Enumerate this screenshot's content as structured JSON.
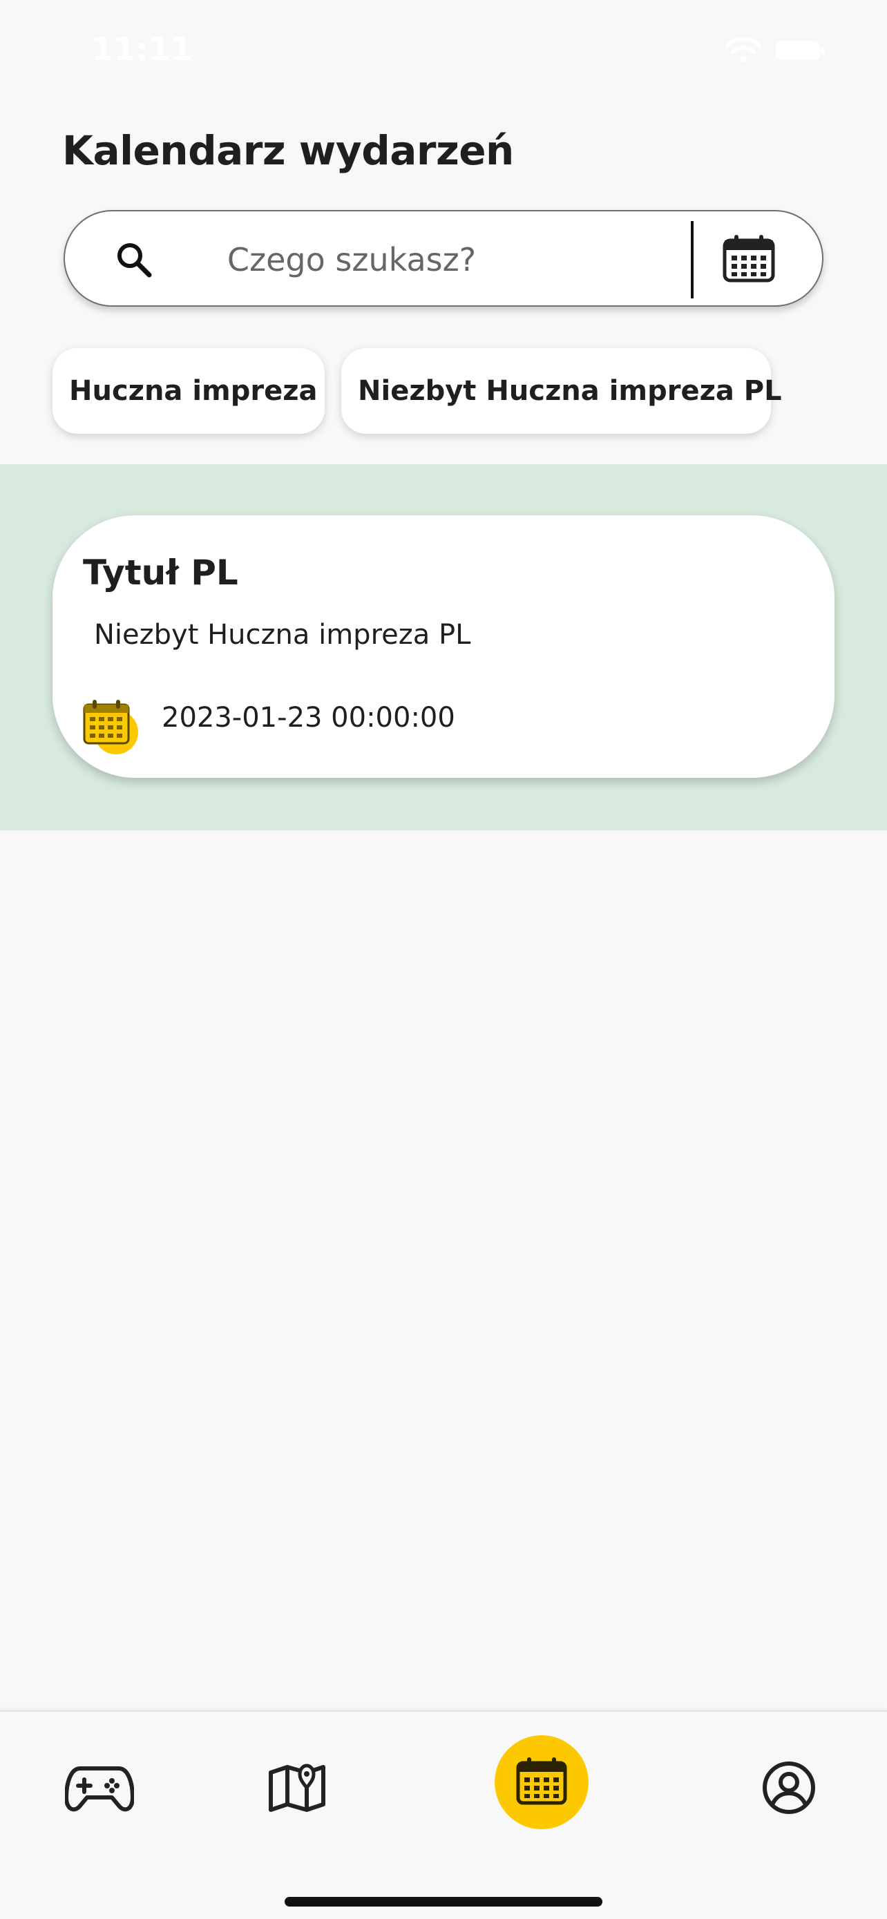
{
  "status_bar": {
    "time": "11:11"
  },
  "header": {
    "title": "Kalendarz wydarzeń"
  },
  "search": {
    "placeholder": "Czego szukasz?",
    "value": ""
  },
  "filters": {
    "chips": [
      {
        "label": "Huczna impreza"
      },
      {
        "label": "Niezbyt Huczna impreza PL"
      }
    ]
  },
  "events": [
    {
      "title": "Tytuł PL",
      "category": "Niezbyt Huczna impreza PL",
      "date": "2023-01-23 00:00:00"
    }
  ],
  "bottom_nav": {
    "items": [
      {
        "icon": "gamepad-icon",
        "active": false
      },
      {
        "icon": "map-pin-icon",
        "active": false
      },
      {
        "icon": "calendar-icon",
        "active": true
      },
      {
        "icon": "user-profile-icon",
        "active": false
      }
    ]
  },
  "colors": {
    "accent": "#fcc800",
    "results_background": "#d7eadd",
    "page_background": "#f8f8f8",
    "text": "#1f1f1f"
  }
}
